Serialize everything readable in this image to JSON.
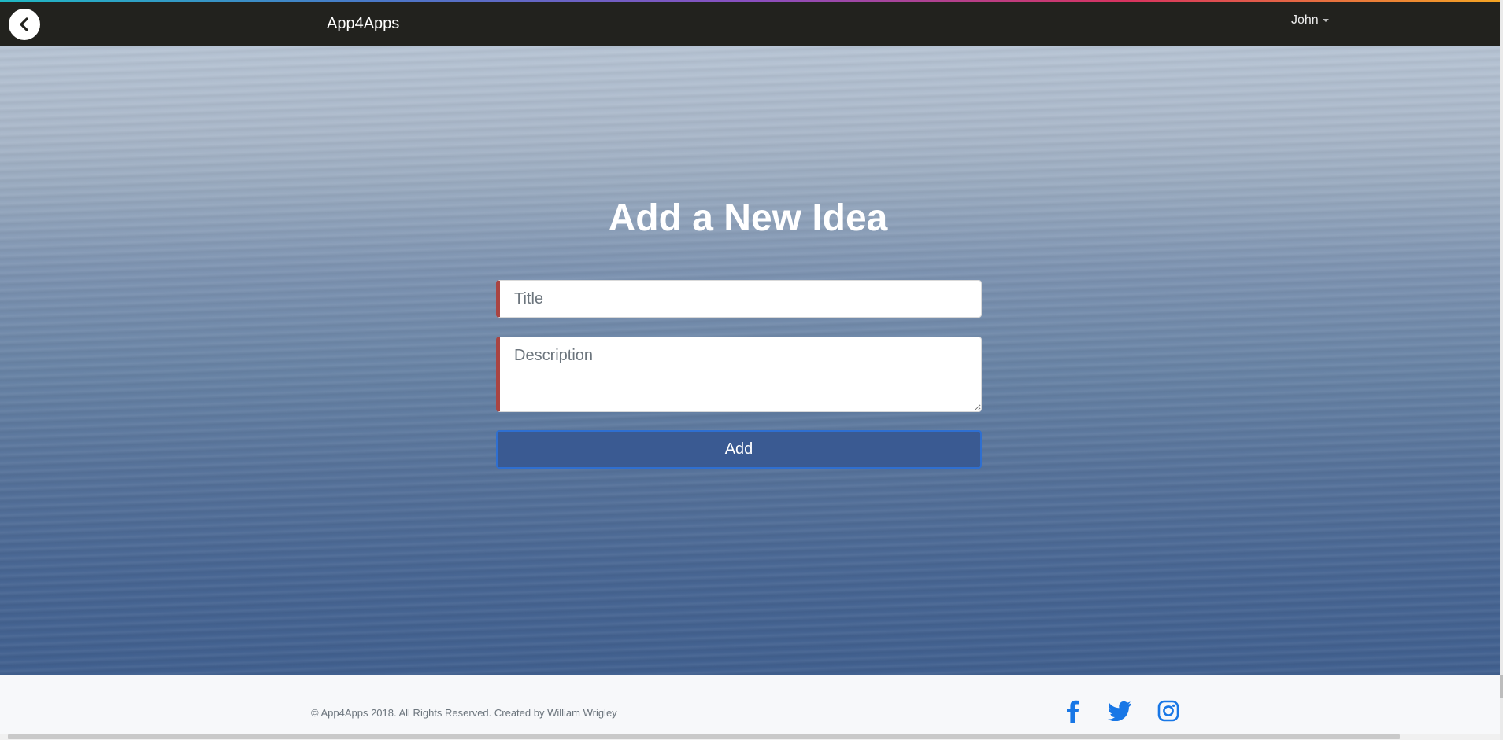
{
  "navbar": {
    "back_icon": "chevron-left-icon",
    "brand": "App4Apps",
    "user_label": "John",
    "user_caret_icon": "caret-down-icon",
    "background": "#22221e"
  },
  "main": {
    "heading": "Add a New Idea",
    "title_field": {
      "placeholder": "Title",
      "value": ""
    },
    "description_field": {
      "placeholder": "Description",
      "value": ""
    },
    "add_button_label": "Add",
    "accent_color": "#3a5a92",
    "invalid_border_color": "#a94442"
  },
  "footer": {
    "copyright": "© App4Apps 2018. All Rights Reserved. Created by William Wrigley",
    "social_icons": [
      "facebook-icon",
      "twitter-icon",
      "instagram-icon"
    ],
    "social_color": "#1877e6"
  }
}
